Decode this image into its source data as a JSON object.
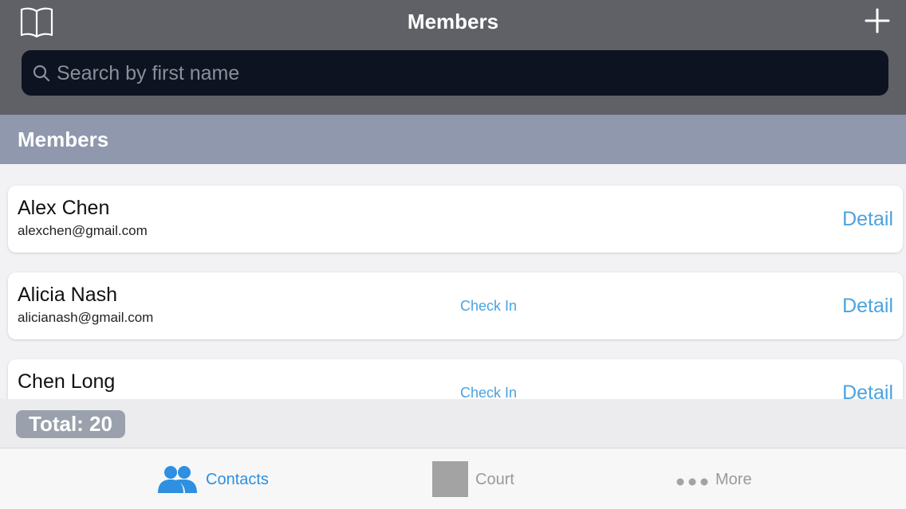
{
  "header": {
    "title": "Members",
    "book_icon": "book-icon",
    "add_icon": "plus-icon"
  },
  "search": {
    "placeholder": "Search by first name",
    "icon": "search-icon"
  },
  "section": {
    "title": "Members"
  },
  "members": [
    {
      "name": "Alex Chen",
      "email": "alexchen@gmail.com",
      "check_in": "",
      "detail": "Detail"
    },
    {
      "name": "Alicia Nash",
      "email": "alicianash@gmail.com",
      "check_in": "Check In",
      "detail": "Detail"
    },
    {
      "name": "Chen Long",
      "email": "",
      "check_in": "Check In",
      "detail": "Detail"
    }
  ],
  "footer": {
    "total": "Total: 20"
  },
  "tabs": [
    {
      "label": "Contacts",
      "icon": "contacts-icon",
      "active": true
    },
    {
      "label": "Court",
      "icon": "court-icon",
      "active": false
    },
    {
      "label": "More",
      "icon": "more-icon",
      "active": false
    }
  ],
  "colors": {
    "header_bg": "#5f6166",
    "search_bg": "#0e1322",
    "section_bg": "#8f98ac",
    "accent": "#4aa3df",
    "active_tab": "#2f8fe0",
    "inactive_tab": "#9a9a9a"
  }
}
